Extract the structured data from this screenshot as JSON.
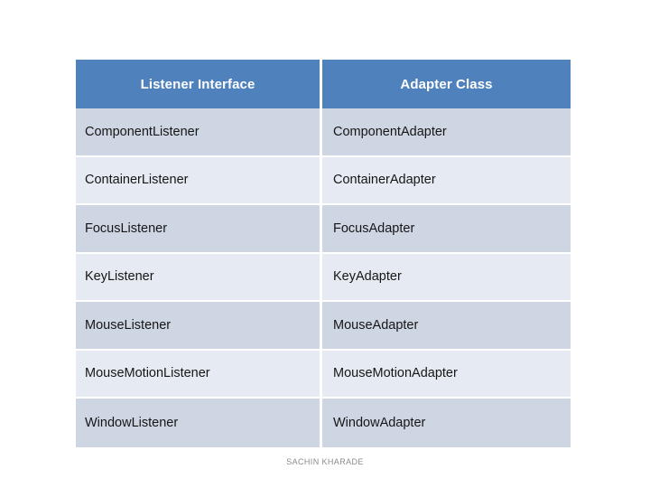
{
  "table": {
    "columns": [
      {
        "key": "listener",
        "header": "Listener Interface"
      },
      {
        "key": "adapter",
        "header": "Adapter Class"
      }
    ],
    "rows": [
      {
        "listener": "ComponentListener",
        "adapter": "ComponentAdapter"
      },
      {
        "listener": "ContainerListener",
        "adapter": "ContainerAdapter"
      },
      {
        "listener": "FocusListener",
        "adapter": "FocusAdapter"
      },
      {
        "listener": "KeyListener",
        "adapter": "KeyAdapter"
      },
      {
        "listener": "MouseListener",
        "adapter": "MouseAdapter"
      },
      {
        "listener": "MouseMotionListener",
        "adapter": "MouseMotionAdapter"
      },
      {
        "listener": "WindowListener",
        "adapter": "WindowAdapter"
      }
    ]
  },
  "footer": {
    "credit": "SACHIN KHARADE"
  },
  "colors": {
    "header_background": "#4f81bd",
    "header_text": "#ffffff",
    "band_dark": "#ced6e3",
    "band_light": "#e6ebf3",
    "cell_text": "#161616",
    "footer_text": "#8a8a8a",
    "slide_background": "#ffffff"
  }
}
